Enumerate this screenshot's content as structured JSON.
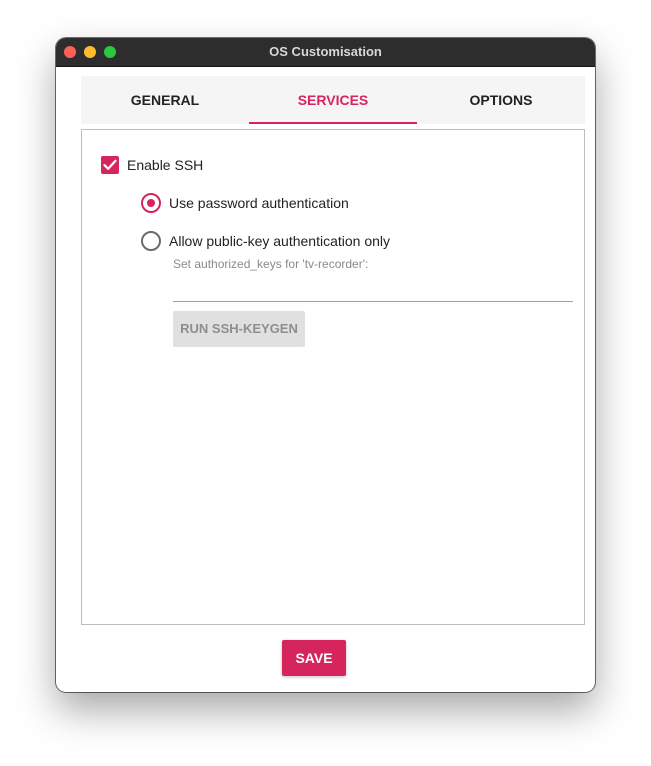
{
  "window": {
    "title": "OS Customisation"
  },
  "tabs": [
    {
      "label": "GENERAL",
      "selected": false
    },
    {
      "label": "SERVICES",
      "selected": true
    },
    {
      "label": "OPTIONS",
      "selected": false
    }
  ],
  "services": {
    "enable_ssh": {
      "label": "Enable SSH",
      "checked": true
    },
    "auth_password": {
      "label": "Use password authentication",
      "selected": true
    },
    "auth_pubkey": {
      "label": "Allow public-key authentication only",
      "selected": false
    },
    "authorized_keys_hint": "Set authorized_keys for 'tv-recorder':",
    "authorized_keys_value": "",
    "keygen_button": "RUN SSH-KEYGEN"
  },
  "footer": {
    "save_label": "SAVE"
  },
  "colors": {
    "accent": "#d6255c",
    "titlebar": "#2e2d2d",
    "disabled_button": "#e0e0e0"
  },
  "icons": [
    "close-dot-icon",
    "minimize-dot-icon",
    "maximize-dot-icon",
    "checkmark-icon"
  ]
}
